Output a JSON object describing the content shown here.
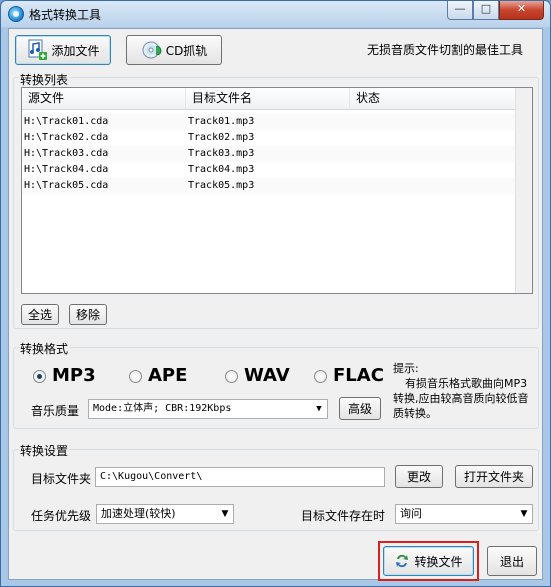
{
  "window": {
    "title": "格式转换工具",
    "controls": {
      "minimize": "—",
      "maximize": "□",
      "close": "✕"
    }
  },
  "toolbar": {
    "add_file": "添加文件",
    "cd_rip": "CD抓轨",
    "slogan": "无损音质文件切割的最佳工具"
  },
  "convert_list": {
    "group_label": "转换列表",
    "columns": [
      "源文件",
      "目标文件名",
      "状态"
    ],
    "rows": [
      {
        "source": "H:\\Track01.cda",
        "target": "Track01.mp3",
        "status": ""
      },
      {
        "source": "H:\\Track02.cda",
        "target": "Track02.mp3",
        "status": ""
      },
      {
        "source": "H:\\Track03.cda",
        "target": "Track03.mp3",
        "status": ""
      },
      {
        "source": "H:\\Track04.cda",
        "target": "Track04.mp3",
        "status": ""
      },
      {
        "source": "H:\\Track05.cda",
        "target": "Track05.mp3",
        "status": ""
      }
    ],
    "select_all": "全选",
    "remove": "移除"
  },
  "format": {
    "group_label": "转换格式",
    "options": [
      {
        "label": "MP3",
        "checked": true
      },
      {
        "label": "APE",
        "checked": false
      },
      {
        "label": "WAV",
        "checked": false
      },
      {
        "label": "FLAC",
        "checked": false
      }
    ],
    "quality_label": "音乐质量",
    "quality_value": "Mode:立体声; CBR:192Kbps",
    "advanced": "高级",
    "hint_title": "提示:",
    "hint_body": "有损音乐格式歌曲向MP3转换,应由较高音质向较低音质转换。"
  },
  "settings": {
    "group_label": "转换设置",
    "target_folder_label": "目标文件夹",
    "target_folder_value": "C:\\Kugou\\Convert\\",
    "change": "更改",
    "open_folder": "打开文件夹",
    "priority_label": "任务优先级",
    "priority_value": "加速处理(较快)",
    "exists_label": "目标文件存在时",
    "exists_value": "询问"
  },
  "footer": {
    "convert": "转换文件",
    "exit": "退出"
  },
  "colors": {
    "highlight_border": "#d8201e",
    "accent": "#3c7fb1"
  }
}
